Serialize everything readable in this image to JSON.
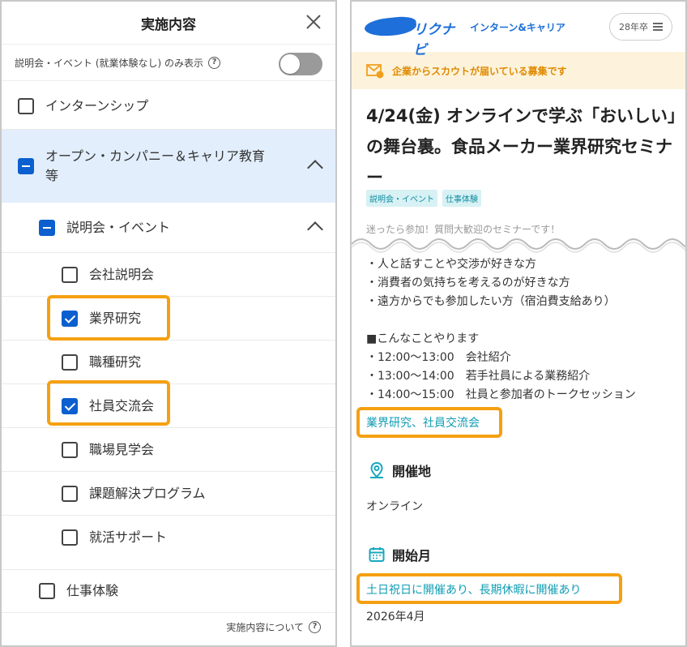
{
  "left_panel": {
    "title": "実施内容",
    "toggle_label": "説明会・イベント (就業体験なし) のみ表示",
    "help_glyph": "?",
    "items": {
      "internship": "インターンシップ",
      "open_company": "オープン・カンパニー＆キャリア教育",
      "open_company_cont": "等",
      "briefing_event": "説明会・イベント",
      "company_briefing": "会社説明会",
      "industry_research": "業界研究",
      "job_research": "職種研究",
      "employee_exchange": "社員交流会",
      "workplace_tour": "職場見学会",
      "problem_solving": "課題解決プログラム",
      "job_support": "就活サポート",
      "work_experience": "仕事体験"
    },
    "footer_link": "実施内容について"
  },
  "right_panel": {
    "logo_text": "リクナビ",
    "subtitle": "インターン&キャリア",
    "year_button": "28年卒",
    "banner_text": "企業からスカウトが届いている募集です",
    "title": "4/24(金) オンラインで学ぶ「おいしい」の舞台裏。食品メーカー業界研究セミナー",
    "tags": [
      "説明会・イベント",
      "仕事体験"
    ],
    "faded_line": "迷ったら参加！質問大歓迎のセミナーです！",
    "bullets": [
      "・人と話すことや交渉が好きな方",
      "・消費者の気持ちを考えるのが好きな方",
      "・遠方からでも参加したい方（宿泊費支給あり）"
    ],
    "program_heading": "■こんなことやります",
    "schedule": [
      "・12:00〜13:00　会社紹介",
      "・13:00〜14:00　若手社員による業務紹介",
      "・14:00〜15:00　社員と参加者のトークセッション"
    ],
    "content_types": "業界研究、社員交流会",
    "location_heading": "開催地",
    "location_value": "オンライン",
    "start_heading": "開始月",
    "start_notes": "土日祝日に開催あり、長期休暇に開催あり",
    "start_value": "2026年4月"
  },
  "colors": {
    "accent_blue": "#0b5fcf",
    "highlight_orange": "#f5a012",
    "teal": "#0f9db3",
    "banner_bg": "#fdf3dc"
  }
}
